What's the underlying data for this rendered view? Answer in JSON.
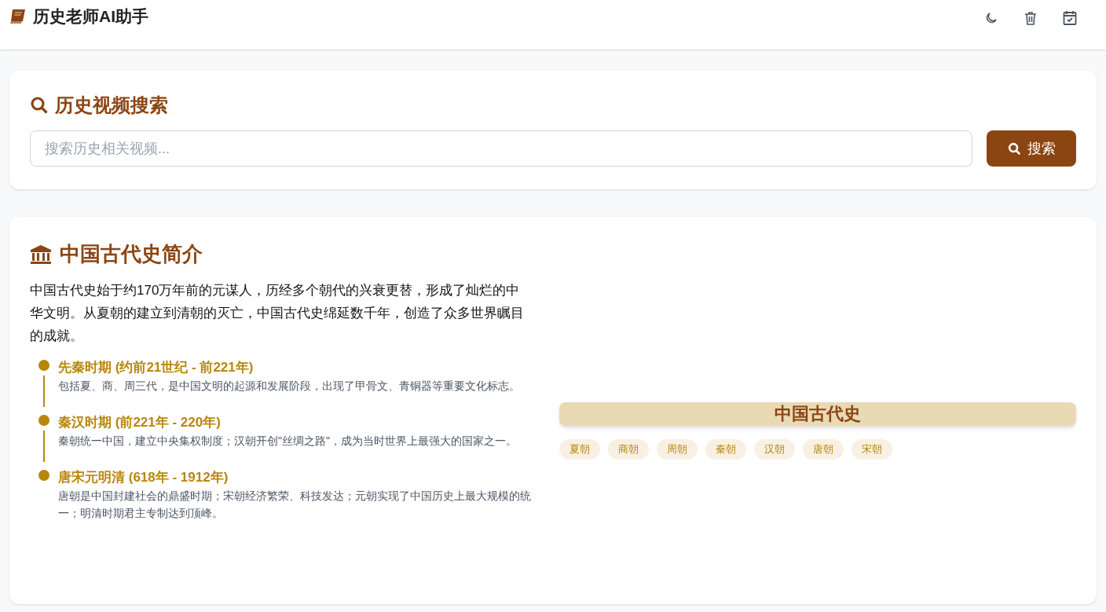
{
  "header": {
    "title": "历史老师AI助手"
  },
  "search": {
    "title": "历史视频搜索",
    "placeholder": "搜索历史相关视频...",
    "button": "搜索"
  },
  "intro": {
    "title": "中国古代史简介",
    "paragraph": "中国古代史始于约170万年前的元谋人，历经多个朝代的兴衰更替，形成了灿烂的中华文明。从夏朝的建立到清朝的灭亡，中国古代史绵延数千年，创造了众多世界瞩目的成就。",
    "timeline": [
      {
        "title": "先秦时期 (约前21世纪 - 前221年)",
        "text": "包括夏、商、周三代，是中国文明的起源和发展阶段，出现了甲骨文、青铜器等重要文化标志。"
      },
      {
        "title": "秦汉时期 (前221年 - 220年)",
        "text": "秦朝统一中国，建立中央集权制度；汉朝开创\"丝绸之路\"，成为当时世界上最强大的国家之一。"
      },
      {
        "title": "唐宋元明清 (618年 - 1912年)",
        "text": "唐朝是中国封建社会的鼎盛时期；宋朝经济繁荣、科技发达；元朝实现了中国历史上最大规模的统一；明清时期君主专制达到顶峰。"
      }
    ],
    "banner": "中国古代史",
    "tags": [
      "夏朝",
      "商朝",
      "周朝",
      "秦朝",
      "汉朝",
      "唐朝",
      "宋朝"
    ]
  }
}
